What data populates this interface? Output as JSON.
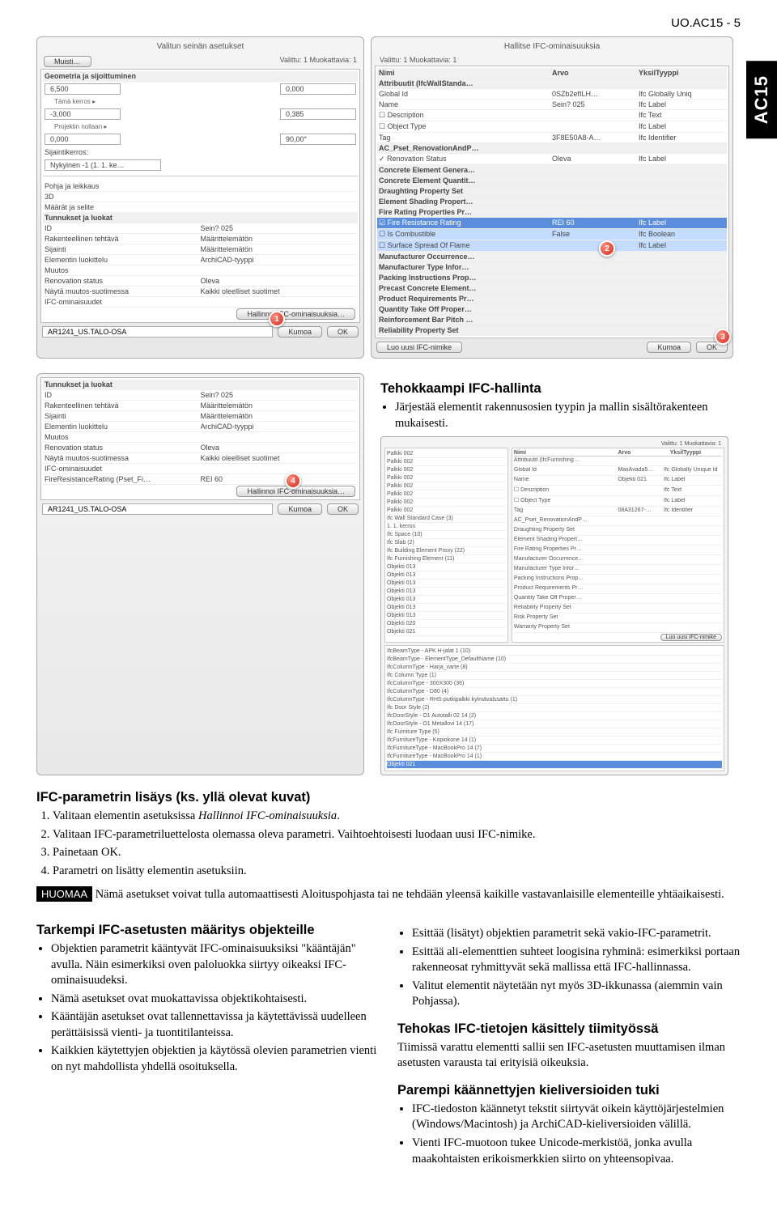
{
  "header_code": "UO.AC15 - 5",
  "side_tab": "AC15",
  "top_left_dialog": {
    "title": "Valitun seinän asetukset",
    "muisti_btn": "Muisti…",
    "valittu": "Valittu: 1 Muokattavia: 1",
    "section_geom": "Geometria ja sijoittuminen",
    "val_6500": "6,500",
    "val_0000": "0,000",
    "tama_kerros": "Tämä kerros ▸",
    "val_neg3": "-3,000",
    "val_0385": "0,385",
    "proj_nollaan": "Projektin nollaan ▸",
    "val_0000b": "0,000",
    "val_90": "90,00°",
    "sijaintikerros_lbl": "Sijaintikerros:",
    "sijaintikerros_val": "Nykyinen -1 (1. 1. ke…",
    "sections": [
      "Pohja ja leikkaus",
      "3D",
      "Määrät ja selite",
      "Tunnukset ja luokat"
    ],
    "table_header": [
      "ID",
      "Sein? 025"
    ],
    "rows": [
      [
        "Rakenteellinen tehtävä",
        "Määrittelemätön"
      ],
      [
        "Sijainti",
        "Määrittelemätön"
      ],
      [
        "Elementin luokittelu",
        "ArchiCAD-tyyppi"
      ],
      [
        "Muutos",
        ""
      ],
      [
        "Renovation status",
        "Oleva"
      ],
      [
        "Näytä muutos-suotimessa",
        "Kaikki oleelliset suotimet"
      ],
      [
        "IFC-ominaisuudet",
        ""
      ]
    ],
    "hallinnoi_btn": "Hallinnoi IFC-ominaisuuksia…",
    "callout_1": "1",
    "layer": "AR1241_US.TALO-OSA",
    "kumoa": "Kumoa",
    "ok": "OK"
  },
  "top_right_dialog": {
    "title": "Hallitse IFC-ominaisuuksia",
    "valittu": "Valittu:  1    Muokattavia:  1",
    "columns": [
      "Nimi",
      "Arvo",
      "YksilTyyppi"
    ],
    "rows": [
      {
        "n": "Attribuutit (IfcWallStanda…",
        "a": "",
        "t": "",
        "bold": true
      },
      {
        "n": "Global Id",
        "a": "0SZb2efILH…",
        "t": "Ifc Globally Uniq"
      },
      {
        "n": "Name",
        "a": "Sein? 025",
        "t": "Ifc Label"
      },
      {
        "n": "☐ Description",
        "a": "",
        "t": "Ifc Text"
      },
      {
        "n": "☐ Object Type",
        "a": "",
        "t": "Ifc Label"
      },
      {
        "n": "Tag",
        "a": "3F8E50A8-A…",
        "t": "Ifc Identifier"
      },
      {
        "n": "AC_Pset_RenovationAndP…",
        "a": "",
        "t": "",
        "bold": true
      },
      {
        "n": "✓ Renovation Status",
        "a": "Oleva",
        "t": "Ifc Label"
      },
      {
        "n": "Concrete Element Genera…",
        "a": "",
        "t": "",
        "bold": true
      },
      {
        "n": "Concrete Element Quantit…",
        "a": "",
        "t": "",
        "bold": true
      },
      {
        "n": "Draughting Property Set",
        "a": "",
        "t": "",
        "bold": true
      },
      {
        "n": "Element Shading Propert…",
        "a": "",
        "t": "",
        "bold": true
      },
      {
        "n": "Fire Rating Properties Pr…",
        "a": "",
        "t": "",
        "bold": true
      },
      {
        "n": "☑ Fire Resistance Rating",
        "a": "REI 60",
        "t": "Ifc Label",
        "hl": true
      },
      {
        "n": "☐ Is Combustible",
        "a": "False",
        "t": "Ifc Boolean",
        "hl2": true
      },
      {
        "n": "☐ Surface Spread Of Flame",
        "a": "",
        "t": "Ifc Label",
        "hl2": true
      },
      {
        "n": "Manufacturer Occurrence…",
        "a": "",
        "t": "",
        "bold": true
      },
      {
        "n": "Manufacturer Type Infor…",
        "a": "",
        "t": "",
        "bold": true
      },
      {
        "n": "Packing Instructions Prop…",
        "a": "",
        "t": "",
        "bold": true
      },
      {
        "n": "Precast Concrete Element…",
        "a": "",
        "t": "",
        "bold": true
      },
      {
        "n": "Product Requirements Pr…",
        "a": "",
        "t": "",
        "bold": true
      },
      {
        "n": "Quantity Take Off Proper…",
        "a": "",
        "t": "",
        "bold": true
      },
      {
        "n": "Reinforcement Bar Pitch …",
        "a": "",
        "t": "",
        "bold": true
      },
      {
        "n": "Reliability Property Set",
        "a": "",
        "t": "",
        "bold": true
      }
    ],
    "callout_2": "2",
    "callout_3": "3",
    "luo_uusi": "Luo uusi IFC-nimike",
    "kumoa": "Kumoa",
    "ok": "OK"
  },
  "mid_left_dialog": {
    "section": "Tunnukset ja luokat",
    "table_header": [
      "ID",
      "Sein? 025"
    ],
    "rows": [
      [
        "Rakenteellinen tehtävä",
        "Määrittelemätön"
      ],
      [
        "Sijainti",
        "Määrittelemätön"
      ],
      [
        "Elementin luokittelu",
        "ArchiCAD-tyyppi"
      ],
      [
        "Muutos",
        ""
      ],
      [
        "Renovation status",
        "Oleva"
      ],
      [
        "Näytä muutos-suotimessa",
        "Kaikki oleelliset suotimet"
      ],
      [
        "IFC-ominaisuudet",
        ""
      ],
      [
        "FireResistanceRating (Pset_Fi…",
        "REI 60"
      ]
    ],
    "callout_4": "4",
    "hallinnoi_btn": "Hallinnoi IFC-ominaisuuksia…",
    "layer": "AR1241_US.TALO-OSA",
    "kumoa": "Kumoa",
    "ok": "OK"
  },
  "right_small": {
    "left_items": [
      "Palkki 002",
      "Palkki 002",
      "Palkki 002",
      "Palkki 002",
      "Palkki 002",
      "Palkki 002",
      "Palkki 002",
      "Palkki 002",
      "Ifc Wall Standard Case (3)",
      "1. 1. kerros",
      "Ifc Space (10)",
      "Ifc Slab (2)",
      "Ifc Building Element Proxy (22)",
      "Ifc Furnishing Element (11)",
      "Objekti 013",
      "Objekti 013",
      "Objekti 013",
      "Objekti 013",
      "Objekti 013",
      "Objekti 013",
      "Objekti 013",
      "Objekti 020",
      "Objekti 021"
    ],
    "right_items": [
      "Attribuutit (IfcFurnishing…",
      "Global Id",
      "Name",
      "☐ Description",
      "☐ Object Type",
      "Tag",
      "AC_Pset_RenovationAndP…",
      "Draughting Property Set",
      "Element Shading Propert…",
      "Fire Rating Properties Pr…",
      "Manufacturer Occurrence…",
      "Manufacturer Type Infor…",
      "Packing Instructions Prop…",
      "Product Requirements Pr…",
      "Quantity Take Off Proper…",
      "Reliability Property Set",
      "Risk Property Set",
      "Warranty Property Set"
    ],
    "right_vals": {
      "gid": "MaxAvada5…",
      "name": "Objekti 021",
      "tag": "08A31267-…"
    },
    "right_types": {
      "gid": "Ifc Globally Unique Id",
      "name": "Ifc Label",
      "desc": "Ifc Text",
      "otype": "Ifc Label",
      "tag": "Ifc Identifier"
    },
    "luo_uusi": "Luo uusi IFC-nimike",
    "bottom_items": [
      "IfcBeamType - APK H-jalat 1 (10)",
      "IfcBeamType - ElementType_DefaultName (10)",
      "IfcColumnType - Harja_varte (8)",
      "Ifc Column Type (1)",
      "IfcColumnType - 300X300 (36)",
      "IfcColumnType - D80 (4)",
      "IfcColumnType - RHS-putkipalkki kylmävalssattu (1)",
      "Ifc Door Style (2)",
      "IfcDoorStyle - O1 Autotalli 02 14 (2)",
      "IfcDoorStyle - O1 Metallovi 14 (17)",
      "Ifc Furniture Type (5)",
      "IfcFurnitureType - Kopiokone 14 (1)",
      "IfcFurnitureType - MacBookPro 14 (7)",
      "IfcFurnitureType - MacBookPro 14 (1)"
    ],
    "selected": "Objekti 021",
    "valittu": "Valittu: 1   Muokattavia: 1",
    "cols": [
      "Nimi",
      "Arvo",
      "YksilTyyppi"
    ]
  },
  "text": {
    "subhead_tehokkaampi": "Tehokkaampi IFC-hallinta",
    "tehokkaampi_bullet": "Järjestää elementit rakennusosien tyypin ja mallin sisältörakenteen mukaisesti.",
    "ifc_param_title": "IFC-parametrin lisäys (ks. yllä olevat kuvat)",
    "steps": [
      "Valitaan elementin asetuksissa Hallinnoi IFC-ominaisuuksia.",
      "Valitaan IFC-parametriluettelosta olemassa oleva parametri. Vaihtoehtoisesti luodaan uusi IFC-nimike.",
      "Painetaan OK.",
      "Parametri on lisätty elementin asetuksiin."
    ],
    "huomaa_label": "HUOMAA",
    "huomaa_text": " Nämä asetukset voivat tulla automaattisesti Aloituspohjasta tai ne tehdään yleensä kaikille vastavanlaisille elementeille yhtäaikaisesti.",
    "tarkempi_title": "Tarkempi IFC-asetusten määritys objekteille",
    "tarkempi_bullets": [
      "Objektien parametrit kääntyvät IFC-ominaisuuksiksi \"kääntäjän\" avulla. Näin esimerkiksi oven paloluokka siirtyy oikeaksi IFC-ominaisuudeksi.",
      "Nämä asetukset ovat muokattavissa objektikohtaisesti.",
      "Kääntäjän asetukset ovat tallennettavissa ja käytettävissä uudelleen perättäisissä vienti- ja tuontitilanteissa.",
      "Kaikkien käytettyjen objektien ja käytössä olevien parametrien vienti on nyt mahdollista yhdellä osoituksella."
    ],
    "right_col_bullets": [
      "Esittää (lisätyt) objektien parametrit sekä vakio-IFC-parametrit.",
      "Esittää ali-elementtien suhteet loogisina ryhminä: esimerkiksi portaan rakenneosat ryhmittyvät sekä mallissa että IFC-hallinnassa.",
      "Valitut elementit näytetään nyt myös 3D-ikkunassa (aiemmin vain Pohjassa)."
    ],
    "tehokas_title": "Tehokas IFC-tietojen käsittely tiimityössä",
    "tehokas_para": "Tiimissä varattu elementti sallii sen IFC-asetusten muuttamisen ilman asetusten varausta tai erityisiä oikeuksia.",
    "parempi_title": "Parempi käännettyjen kieliversioiden tuki",
    "parempi_bullets": [
      "IFC-tiedoston käännetyt tekstit siirtyvät oikein käyttöjärjestelmien (Windows/Macintosh) ja ArchiCAD-kieliversioiden välillä.",
      "Vienti IFC-muotoon tukee Unicode-merkistöä, jonka avulla maakohtaisten erikoismerkkien siirto on yhteensopivaa."
    ]
  }
}
